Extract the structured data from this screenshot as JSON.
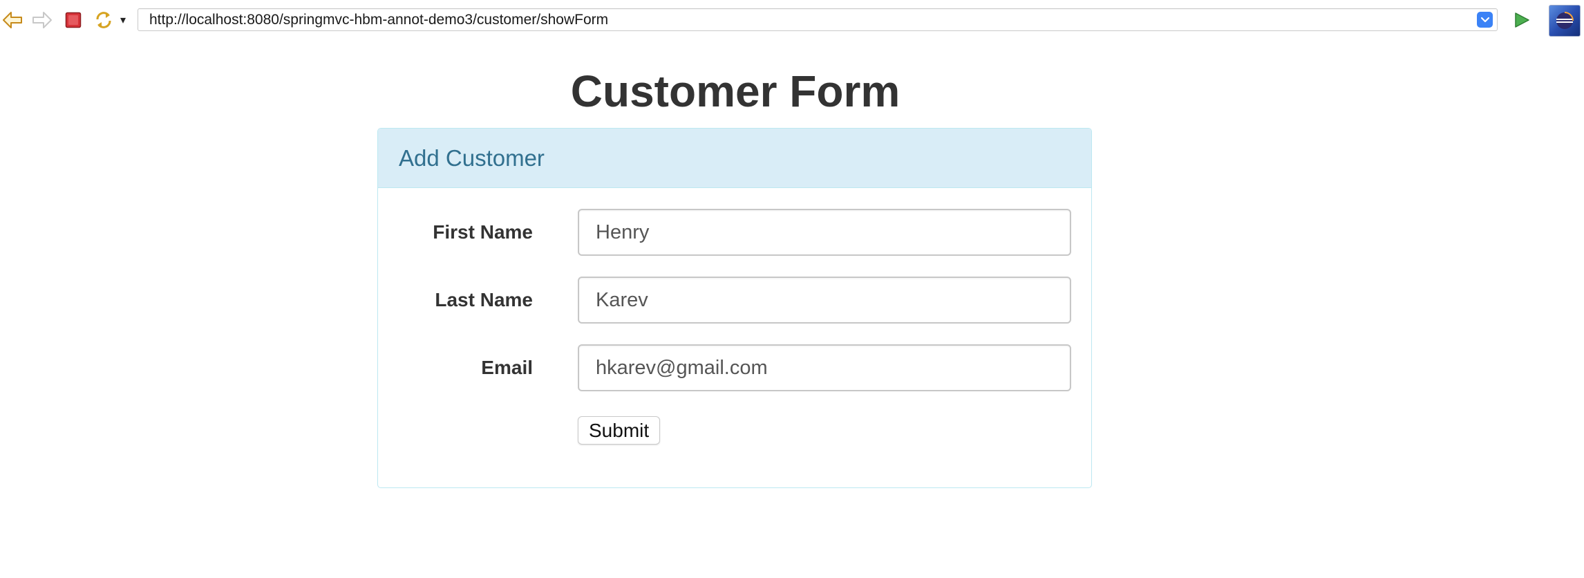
{
  "browser": {
    "url": "http://localhost:8080/springmvc-hbm-annot-demo3/customer/showForm",
    "icons": {
      "back": "back-arrow-icon",
      "forward": "forward-arrow-icon",
      "stop": "stop-icon",
      "refresh": "refresh-icon",
      "refresh_menu": "chevron-down-icon",
      "address_dropdown": "chevron-down-icon",
      "go": "play-icon",
      "eclipse": "eclipse-logo-icon"
    },
    "refresh_menu_glyph": "▾"
  },
  "page": {
    "title": "Customer Form"
  },
  "panel": {
    "heading": "Add Customer"
  },
  "form": {
    "first_name": {
      "label": "First Name",
      "value": "Henry"
    },
    "last_name": {
      "label": "Last Name",
      "value": "Karev"
    },
    "email": {
      "label": "Email",
      "value": "hkarev@gmail.com"
    },
    "submit_label": "Submit"
  },
  "colors": {
    "panel_heading_bg": "#d9edf7",
    "panel_heading_text": "#31708f",
    "panel_border": "#bce8f1",
    "text": "#333333",
    "address_dropdown": "#3b82f6"
  }
}
